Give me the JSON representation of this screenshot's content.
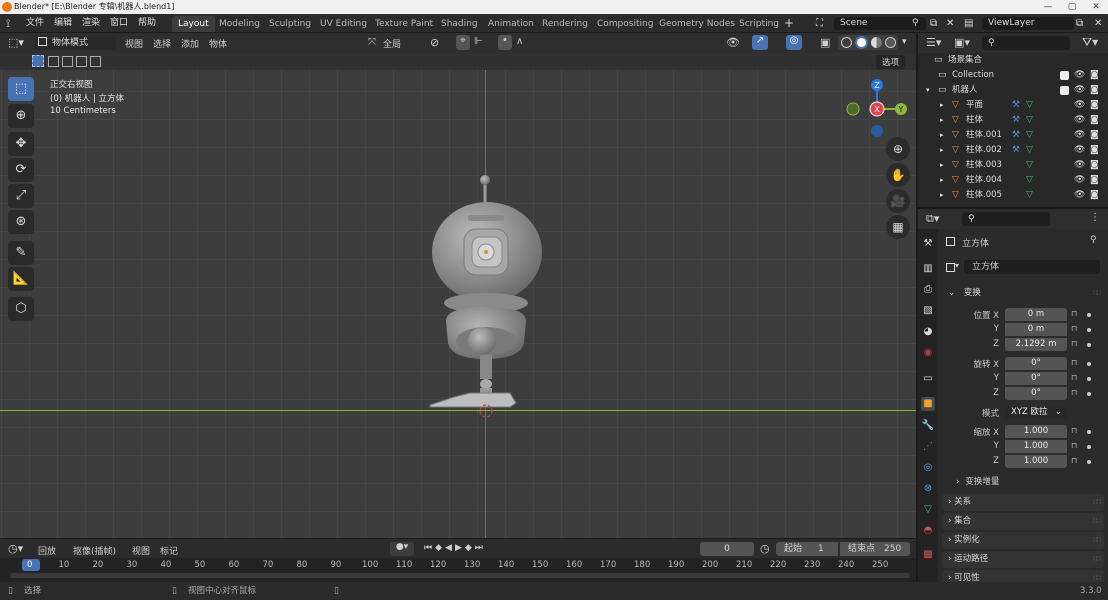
{
  "window": {
    "title": "Blender* [E:\\Blender 专辑\\机器人.blend1]",
    "controls": [
      "—",
      "▢",
      "✕"
    ]
  },
  "menus": [
    "文件",
    "编辑",
    "渲染",
    "窗口",
    "帮助"
  ],
  "workspaces": [
    "Layout",
    "Modeling",
    "Sculpting",
    "UV Editing",
    "Texture Paint",
    "Shading",
    "Animation",
    "Rendering",
    "Compositing",
    "Geometry Nodes",
    "Scripting"
  ],
  "scene": {
    "name": "Scene",
    "view_layer": "ViewLayer"
  },
  "viewport": {
    "mode": "物体模式",
    "menus": [
      "视图",
      "选择",
      "添加",
      "物体"
    ],
    "transform_orientation": "全局",
    "options_label": "选项",
    "overlay_lines": [
      "正交右视图",
      "(0) 机器人 | 立方体",
      "10 Centimeters"
    ],
    "gizmo_axes": {
      "x": "X",
      "y": "Y",
      "z": "Z"
    },
    "colors": {
      "x_axis": "#e8404a",
      "y_axis": "#8cb83a",
      "z_axis": "#2a78d8"
    }
  },
  "timeline": {
    "menus": [
      "回放",
      "抠像(插帧)",
      "视图",
      "标记"
    ],
    "current_frame": "0",
    "start_label": "起始",
    "start": "1",
    "end_label": "结束点",
    "end": "250",
    "ruler": [
      "0",
      "10",
      "20",
      "30",
      "40",
      "50",
      "60",
      "70",
      "80",
      "90",
      "100",
      "110",
      "120",
      "130",
      "140",
      "150",
      "160",
      "170",
      "180",
      "190",
      "200",
      "210",
      "220",
      "230",
      "240",
      "250"
    ]
  },
  "statusbar": {
    "left": "选择",
    "middle": "视图中心对齐鼠标",
    "version": "3.3.0"
  },
  "outliner": {
    "root": "场景集合",
    "items": [
      {
        "name": "Collection",
        "level": 1
      },
      {
        "name": "机器人",
        "level": 1
      },
      {
        "name": "平面",
        "level": 2,
        "modifier": true
      },
      {
        "name": "柱体",
        "level": 2,
        "modifier": true
      },
      {
        "name": "柱体.001",
        "level": 2,
        "modifier": true
      },
      {
        "name": "柱体.002",
        "level": 2,
        "modifier": true
      },
      {
        "name": "柱体.003",
        "level": 2,
        "modifier": false
      },
      {
        "name": "柱体.004",
        "level": 2,
        "modifier": false
      },
      {
        "name": "柱体.005",
        "level": 2,
        "modifier": false
      }
    ]
  },
  "properties": {
    "object_name": "立方体",
    "data_name": "立方体",
    "transform_label": "变换",
    "location_label": "位置 X",
    "rotation_label": "旋转 X",
    "scale_label": "缩放 X",
    "axis_y": "Y",
    "axis_z": "Z",
    "location": [
      "0 m",
      "0 m",
      "2.1292 m"
    ],
    "rotation": [
      "0°",
      "0°",
      "0°"
    ],
    "mode_label": "模式",
    "rotation_mode": "XYZ 欧拉",
    "scale": [
      "1.000",
      "1.000",
      "1.000"
    ],
    "delta_label": "变换增量",
    "sections": [
      "关系",
      "集合",
      "实例化",
      "运动路径",
      "可见性"
    ]
  }
}
